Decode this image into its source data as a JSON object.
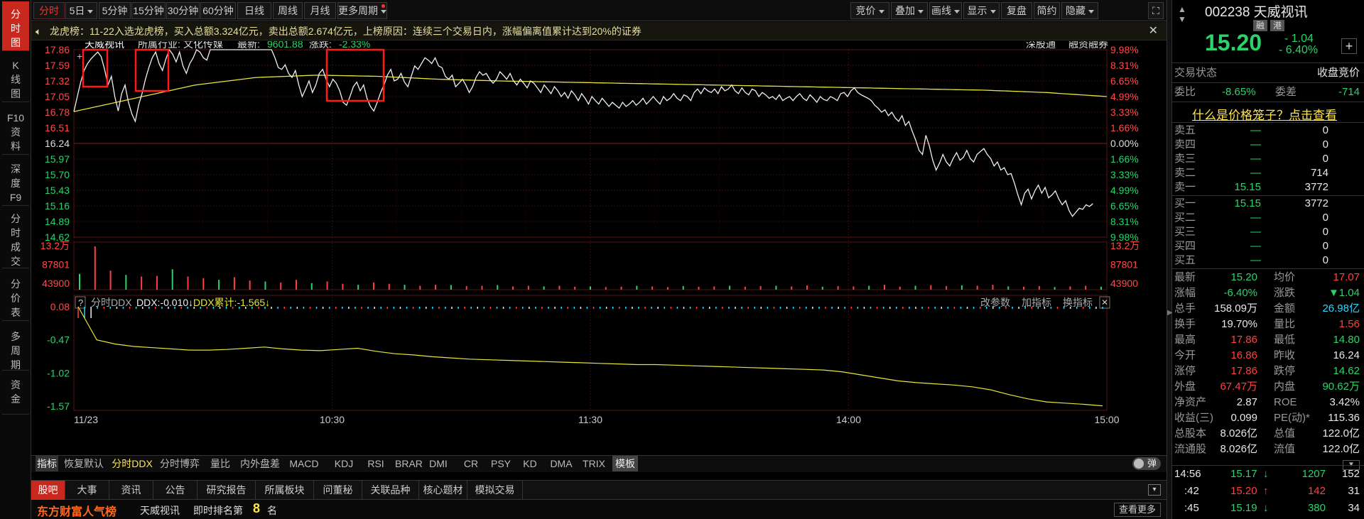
{
  "left_nav": [
    {
      "label": [
        "分",
        "时",
        "图"
      ],
      "active": true
    },
    {
      "label": [
        "K",
        "线",
        "图"
      ]
    },
    {
      "label": [
        "F10",
        "资",
        "料"
      ]
    },
    {
      "label": [
        "深",
        "度",
        "F9"
      ]
    },
    {
      "label": [
        "分",
        "时",
        "成",
        "交"
      ]
    },
    {
      "label": [
        "分",
        "价",
        "表"
      ]
    },
    {
      "label": [
        "多",
        "周",
        "期"
      ]
    },
    {
      "label": [
        "资",
        "金"
      ]
    }
  ],
  "toolbar": {
    "periods": [
      "分时",
      "5日",
      "5分钟",
      "15分钟",
      "30分钟",
      "60分钟",
      "日线",
      "周线",
      "月线",
      "更多周期"
    ],
    "right": [
      "竞价",
      "叠加",
      "画线",
      "显示",
      "复盘",
      "简约",
      "隐藏"
    ]
  },
  "notice": {
    "text": "龙虎榜：11-22入选龙虎榜，买入总额3.324亿元，卖出总额2.674亿元，上榜原因：连续三个交易日内，涨幅偏离值累计达到20%的证券"
  },
  "chart_header": {
    "name": "天威视讯",
    "industry_label": "所属行业:",
    "industry": "文化传媒",
    "latest_label": "最新:",
    "latest": "9601.88",
    "change_label": "涨跌:",
    "change": "-2.33%",
    "right_links": [
      "深股通",
      "融资融券"
    ]
  },
  "chart_data": {
    "type": "line",
    "title": "",
    "ylim": [
      14.62,
      17.86
    ],
    "prev_close": 16.24,
    "y_ticks_left": [
      "17.86",
      "17.59",
      "17.32",
      "17.05",
      "16.78",
      "16.51",
      "16.24",
      "15.97",
      "15.70",
      "15.43",
      "15.16",
      "14.89",
      "14.62"
    ],
    "y_ticks_right": [
      "9.98%",
      "8.31%",
      "6.65%",
      "4.99%",
      "3.33%",
      "1.66%",
      "0.00%",
      "1.66%",
      "3.33%",
      "4.99%",
      "6.65%",
      "8.31%",
      "9.98%"
    ],
    "x_ticks": [
      "11/23",
      "10:30",
      "11:30",
      "14:00",
      "15:00"
    ],
    "volume_ticks": [
      "13.2万",
      "87801",
      "43900"
    ],
    "ddx_ticks": [
      "0.08",
      "-0.47",
      "-1.02",
      "-1.57"
    ],
    "price": [
      16.79,
      17.05,
      17.3,
      17.5,
      17.62,
      17.7,
      17.76,
      17.82,
      17.74,
      17.52,
      17.25,
      17.4,
      17.05,
      16.8,
      17.1,
      17.25,
      16.95,
      16.75,
      16.62,
      16.9,
      17.1,
      17.35,
      17.55,
      17.72,
      17.82,
      17.62,
      17.5,
      17.7,
      17.86,
      17.78,
      17.65,
      17.82,
      17.58,
      17.45,
      17.62,
      17.72,
      17.86,
      17.82,
      17.72,
      17.68,
      17.86,
      17.86,
      17.86,
      17.86,
      17.86,
      17.86,
      17.86,
      17.86,
      17.86,
      17.86,
      17.86,
      17.86,
      17.86,
      17.86,
      17.86,
      17.86,
      17.86,
      17.86,
      17.86,
      17.72,
      17.55,
      17.52,
      17.6,
      17.45,
      17.38,
      17.5,
      17.25,
      17.05,
      17.18,
      17.32,
      17.12,
      17.25,
      17.45,
      17.52,
      17.35,
      17.22,
      17.35,
      17.28,
      17.15,
      16.95,
      16.9,
      17.05,
      17.22,
      17.3,
      17.15,
      17.25,
      17.02,
      16.88,
      16.8,
      16.95,
      17.12,
      17.25,
      17.42,
      17.52,
      17.32,
      17.35,
      17.45,
      17.3,
      17.22,
      17.4,
      17.58,
      17.52,
      17.62,
      17.72,
      17.68,
      17.62,
      17.72,
      17.58,
      17.55,
      17.4,
      17.35,
      17.42,
      17.22,
      17.28,
      17.35,
      17.25,
      17.12,
      17.22,
      17.38,
      17.48,
      17.42,
      17.45,
      17.35,
      17.28,
      17.35,
      17.48,
      17.42,
      17.35,
      17.45,
      17.32,
      17.25,
      17.35,
      17.28,
      17.2,
      17.32,
      17.28,
      17.2,
      17.12,
      17.25,
      17.18,
      17.1,
      17.22,
      17.15,
      17.05,
      17.12,
      17.02,
      17.15,
      17.08,
      16.98,
      17.1,
      17.02,
      16.92,
      17.05,
      16.98,
      16.92,
      17.02,
      16.95,
      16.88,
      16.95,
      16.9,
      16.85,
      16.95,
      16.88,
      16.92,
      16.98,
      16.9,
      16.95,
      17.02,
      16.92,
      16.98,
      17.05,
      16.98,
      16.92,
      17.05,
      16.98,
      17.02,
      17.1,
      17.02,
      16.98,
      17.08,
      17.05,
      16.98,
      17.12,
      17.18,
      17.1,
      17.2,
      17.15,
      17.12,
      17.18,
      17.1,
      17.22,
      17.15,
      17.18,
      17.25,
      17.15,
      17.1,
      17.2,
      17.12,
      17.08,
      17.18,
      17.15,
      17.05,
      17.12,
      17.08,
      17.02,
      17.05,
      17.0,
      17.08,
      16.98,
      17.02,
      17.05,
      16.98,
      17.05,
      17.1,
      17.02,
      16.98,
      17.08,
      17.02,
      16.95,
      17.05,
      17.0,
      16.98,
      17.05,
      17.02,
      16.98,
      17.1,
      17.12,
      17.05,
      17.15,
      17.2,
      17.12,
      17.08,
      17.05,
      17.02,
      16.98,
      16.9,
      16.85,
      16.78,
      16.82,
      16.72,
      16.78,
      16.68,
      16.62,
      16.72,
      16.55,
      16.62,
      16.45,
      16.3,
      16.12,
      16.05,
      16.38,
      16.2,
      15.95,
      15.78,
      15.9,
      16.05,
      15.92,
      15.85,
      15.98,
      16.08,
      15.95,
      16.0,
      16.12,
      15.98,
      15.92,
      16.05,
      16.1,
      16.15,
      16.05,
      15.98,
      15.85,
      15.92,
      15.78,
      15.82,
      15.7,
      15.72,
      15.55,
      15.35,
      15.18,
      15.38,
      15.45,
      15.28,
      15.42,
      15.52,
      15.38,
      15.48,
      15.3,
      15.35,
      15.42,
      15.28,
      15.18,
      15.25,
      15.08,
      14.98,
      15.05,
      15.12,
      15.1,
      15.18,
      15.15,
      15.2
    ],
    "avg_price": [
      16.79,
      17.02,
      17.25,
      17.38,
      17.42,
      17.4,
      17.35,
      17.32,
      17.3,
      17.28,
      17.26,
      17.24,
      17.22,
      17.2,
      17.18,
      17.16,
      17.12,
      17.05
    ],
    "volume": [
      48000,
      132000,
      58000,
      45000,
      40000,
      42000,
      62000,
      40000,
      35000,
      30000,
      38000,
      28000,
      25000,
      22000,
      30000,
      20000,
      25000,
      18000,
      15000,
      22000,
      18000,
      15000,
      12000,
      15000,
      14000,
      11000,
      12000,
      14000,
      10000,
      12000,
      10000,
      12000,
      9000,
      10000,
      8000,
      9000,
      12000,
      10000,
      8000,
      11000,
      9000,
      10000,
      12000,
      9000,
      11000,
      12000,
      10000,
      13000,
      9000,
      11000,
      10000,
      12000,
      15000,
      9000,
      12000,
      14000,
      11000,
      13000,
      12000,
      15000,
      10000,
      9000,
      11000,
      8000,
      10000,
      12000,
      9000
    ],
    "ddx": [
      0.08,
      -0.47,
      -0.54,
      -0.58,
      -0.6,
      -0.62,
      -0.64,
      -0.64,
      -0.63,
      -0.61,
      -0.59,
      -0.62,
      -0.64,
      -0.65,
      -0.63,
      -0.61,
      -0.66,
      -0.7,
      -0.72,
      -0.75,
      -0.77,
      -0.79,
      -0.8,
      -0.81,
      -0.82,
      -0.83,
      -0.84,
      -0.85,
      -0.86,
      -0.87,
      -0.88,
      -0.88,
      -0.89,
      -0.9,
      -0.91,
      -0.92,
      -0.93,
      -0.94,
      -0.95,
      -0.96,
      -0.97,
      -1.0,
      -1.05,
      -1.1,
      -1.15,
      -1.18,
      -1.2,
      -1.22,
      -1.25,
      -1.3,
      -1.38,
      -1.45,
      -1.5,
      -1.52,
      -1.54,
      -1.565
    ]
  },
  "ddx_bar": {
    "help": "?",
    "label": "分时DDX",
    "ddx": "DDX:-0.010↓",
    "ddx_cum": "DDX累计:-1.565↓",
    "right": [
      "改参数",
      "加指标",
      "换指标"
    ]
  },
  "indicators": [
    "指标",
    "恢复默认",
    "分时DDX",
    "分时博弈",
    "量比",
    "内外盘差",
    "MACD",
    "KDJ",
    "RSI",
    "BRAR",
    "DMI",
    "CR",
    "PSY",
    "KD",
    "DMA",
    "TRIX",
    "模板"
  ],
  "bullet_label": "弹",
  "tabs": [
    "股吧",
    "大事",
    "资讯",
    "公告",
    "研究报告",
    "所属板块",
    "问董秘",
    "关联品种",
    "核心题材",
    "模拟交易"
  ],
  "bottom": {
    "brand": "东方财富人气榜",
    "name": "天威视讯",
    "rank_label": "即时排名第",
    "rank": "8",
    "rank_unit": "名",
    "more": "查看更多"
  },
  "quote": {
    "code_name": "002238 天威视讯",
    "tags": [
      "融",
      "港"
    ],
    "price": "15.20",
    "change": "- 1.04",
    "change_pct": "- 6.40%",
    "trade_status_label": "交易状态",
    "trade_status": "收盘竞价",
    "wb_label": "委比",
    "wb": "-8.65%",
    "wc_label": "委差",
    "wc": "-714",
    "cage_link": "什么是价格笼子？点击查看",
    "sells": [
      {
        "l": "卖五",
        "p": "—",
        "v": "0"
      },
      {
        "l": "卖四",
        "p": "—",
        "v": "0"
      },
      {
        "l": "卖三",
        "p": "—",
        "v": "0"
      },
      {
        "l": "卖二",
        "p": "—",
        "v": "714"
      },
      {
        "l": "卖一",
        "p": "15.15",
        "v": "3772"
      }
    ],
    "buys": [
      {
        "l": "买一",
        "p": "15.15",
        "v": "3772"
      },
      {
        "l": "买二",
        "p": "—",
        "v": "0"
      },
      {
        "l": "买三",
        "p": "—",
        "v": "0"
      },
      {
        "l": "买四",
        "p": "—",
        "v": "0"
      },
      {
        "l": "买五",
        "p": "—",
        "v": "0"
      }
    ],
    "stats": [
      [
        "最新",
        "15.20",
        "均价",
        "17.07"
      ],
      [
        "涨幅",
        "-6.40%",
        "涨跌",
        "▼1.04"
      ],
      [
        "总手",
        "158.09万",
        "金额",
        "26.98亿"
      ],
      [
        "换手",
        "19.70%",
        "量比",
        "1.56"
      ],
      [
        "最高",
        "17.86",
        "最低",
        "14.80"
      ],
      [
        "今开",
        "16.86",
        "昨收",
        "16.24"
      ],
      [
        "涨停",
        "17.86",
        "跌停",
        "14.62"
      ],
      [
        "外盘",
        "67.47万",
        "内盘",
        "90.62万"
      ],
      [
        "净资产",
        "2.87",
        "ROE",
        "3.42%"
      ],
      [
        "收益(三)",
        "0.099",
        "PE(动)*",
        "115.36"
      ],
      [
        "总股本",
        "8.026亿",
        "总值",
        "122.0亿"
      ],
      [
        "流通股",
        "8.026亿",
        "流值",
        "122.0亿"
      ]
    ],
    "ticks": [
      {
        "t": "14:56",
        "p": "15.17",
        "d": "↓",
        "v": "1207",
        "n": "152"
      },
      {
        "t": ":42",
        "p": "15.20",
        "d": "↑",
        "v": "142",
        "n": "31"
      },
      {
        "t": ":45",
        "p": "15.19",
        "d": "↓",
        "v": "380",
        "n": "34"
      }
    ]
  }
}
